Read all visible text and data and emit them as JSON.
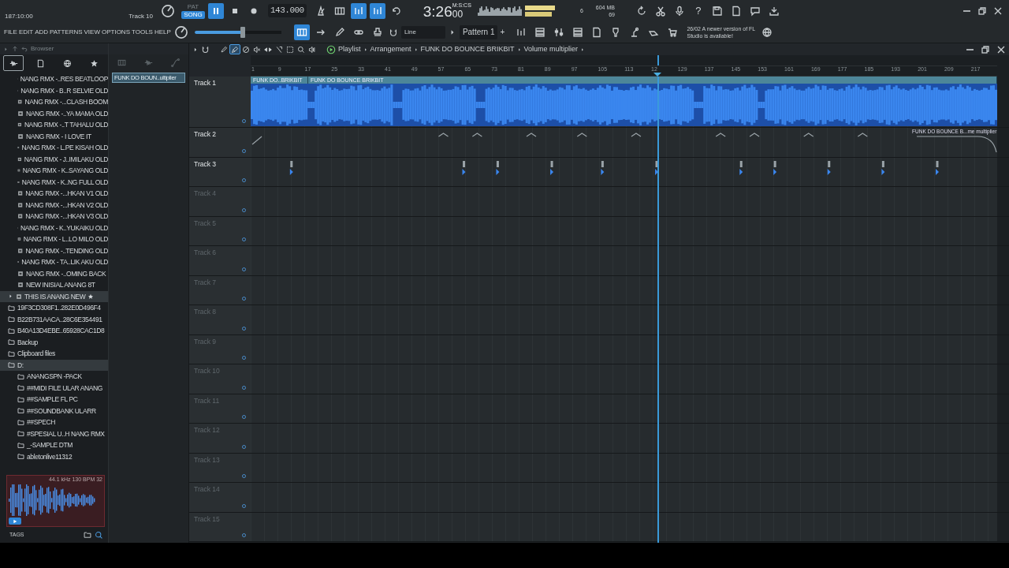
{
  "status": {
    "hint": "187:10:00",
    "track": "Track 10"
  },
  "transport": {
    "modes": [
      {
        "label": "PAT",
        "selected": false
      },
      {
        "label": "SONG",
        "selected": true
      }
    ],
    "playing": true,
    "tempo": "143.000"
  },
  "toggles": [
    {
      "on": false
    },
    {
      "on": false
    },
    {
      "on": true
    },
    {
      "on": true
    },
    {
      "on": false
    }
  ],
  "clock": {
    "time": "3:26",
    "fraction": "00",
    "unit": "M:S:CS"
  },
  "monitor": {
    "cpu": "6",
    "memory": "604 MB",
    "voices": "69"
  },
  "help_label": "?",
  "menu": [
    "FILE",
    "EDIT",
    "ADD",
    "PATTERNS",
    "VIEW",
    "OPTIONS",
    "TOOLS",
    "HELP"
  ],
  "master_volume": {
    "level": 0.56
  },
  "toggles2": [
    {
      "on": true
    },
    {
      "on": false
    },
    {
      "on": false
    },
    {
      "on": false
    },
    {
      "on": false
    }
  ],
  "snap": "Line",
  "pattern": {
    "name": "Pattern 1",
    "add": "+"
  },
  "news": {
    "date": "26/02",
    "text": "A newer version of FL Studio is available!"
  },
  "browser": {
    "title": "Browser",
    "tabs": [
      {
        "selected": true
      },
      {
        "selected": false
      },
      {
        "selected": false
      },
      {
        "selected": false
      }
    ],
    "items": [
      {
        "kind": "file",
        "label": "NANG RMX -..RES BEATLOOP"
      },
      {
        "kind": "file",
        "label": "NANG RMX - B..R SELVIE OLD"
      },
      {
        "kind": "file",
        "label": "NANG RMX -...CLASH BOOM"
      },
      {
        "kind": "file",
        "label": "NANG RMX -..YA MAMA OLD"
      },
      {
        "kind": "file",
        "label": "NANG RMX -..T TAHALU OLD"
      },
      {
        "kind": "file",
        "label": "NANG RMX - I LOVE IT"
      },
      {
        "kind": "file",
        "label": "NANG RMX - L.PE KISAH OLD"
      },
      {
        "kind": "file",
        "label": "NANG RMX - J..IMILAKU OLD"
      },
      {
        "kind": "file",
        "label": "NANG RMX - K..SAYANG OLD"
      },
      {
        "kind": "file",
        "label": "NANG RMX - K..NG FULL OLD"
      },
      {
        "kind": "file",
        "label": "NANG RMX -...HKAN V1 OLD"
      },
      {
        "kind": "file",
        "label": "NANG RMX -...HKAN V2 OLD"
      },
      {
        "kind": "file",
        "label": "NANG RMX -...HKAN V3 OLD"
      },
      {
        "kind": "file",
        "label": "NANG RMX - K..YUKAIKU OLD"
      },
      {
        "kind": "file",
        "label": "NANG RMX - L..LO MILO OLD"
      },
      {
        "kind": "file",
        "label": "NANG RMX -..TENDING OLD"
      },
      {
        "kind": "file",
        "label": "NANG RMX - TA..LIK AKU OLD"
      },
      {
        "kind": "file",
        "label": "NANG RMX -..OMING BACK"
      },
      {
        "kind": "file",
        "label": "NEW INISIAL ANANG 8T"
      },
      {
        "kind": "pinned",
        "label": "THIS IS ANANG NEW",
        "selected": true
      },
      {
        "kind": "folder",
        "label": "19F3CD308F1..282E0D496F4",
        "selected": false
      },
      {
        "kind": "folder",
        "label": "B22B731AACA..28C6E354491",
        "selected": false
      },
      {
        "kind": "folder",
        "label": "B40A13D4EBE..65928CAC1D8",
        "selected": false
      },
      {
        "kind": "folder",
        "label": "Backup",
        "selected": false
      },
      {
        "kind": "folder",
        "label": "Clipboard files",
        "selected": false
      },
      {
        "kind": "folder",
        "label": "D:",
        "selected": true,
        "children": [
          {
            "kind": "folder",
            "label": "ANANGSPN -PACK"
          },
          {
            "kind": "folder",
            "label": "##MIDI FILE ULAR ANANG"
          },
          {
            "kind": "folder",
            "label": "##SAMPLE FL PC"
          },
          {
            "kind": "folder",
            "label": "##SOUNDBANK ULARR"
          },
          {
            "kind": "folder",
            "label": "##SPECH"
          },
          {
            "kind": "folder",
            "label": "#SPESIAL U..H NANG RMX"
          },
          {
            "kind": "folder",
            "label": "_-SAMPLE DTM"
          },
          {
            "kind": "folder",
            "label": "abletonlive11312"
          }
        ]
      }
    ]
  },
  "preview": {
    "info": "44.1 kHz 130 BPM 32",
    "tags": "TAGS"
  },
  "picker": {
    "clips": [
      {
        "label": "FUNK DO BOUN..ultiplier",
        "selected": true
      }
    ]
  },
  "playlist": {
    "tools": [
      {
        "selected": false
      },
      {
        "selected": true
      },
      {
        "selected": false
      },
      {
        "selected": false
      },
      {
        "selected": false
      },
      {
        "selected": false
      },
      {
        "selected": false
      },
      {
        "selected": false
      },
      {
        "selected": false
      }
    ],
    "breadcrumb": [
      "Playlist",
      "Arrangement",
      "FUNK DO BOUNCE BRIKBIT",
      "Volume multiplier"
    ],
    "ruler": [
      "1",
      "9",
      "17",
      "25",
      "33",
      "41",
      "49",
      "57",
      "65",
      "73",
      "81",
      "89",
      "97",
      "105",
      "113",
      "12",
      "129",
      "137",
      "145",
      "153",
      "161",
      "169",
      "177",
      "185",
      "193",
      "201",
      "209",
      "217"
    ],
    "playhead": {
      "level": 0.545
    },
    "tracks": [
      {
        "name": "Track 1",
        "kind": "audio",
        "clips": [
          "FUNK DO..BRIKBIT",
          "FUNK DO BOUNCE BRIKBIT"
        ]
      },
      {
        "name": "Track 2",
        "kind": "automation",
        "clips": [
          "FUNK DO BOUNCE B...me multiplier"
        ]
      },
      {
        "name": "Track 3",
        "kind": "pattern"
      },
      {
        "name": "Track 4",
        "kind": "empty"
      },
      {
        "name": "Track 5",
        "kind": "empty"
      },
      {
        "name": "Track 6",
        "kind": "empty"
      },
      {
        "name": "Track 7",
        "kind": "empty"
      },
      {
        "name": "Track 8",
        "kind": "empty"
      },
      {
        "name": "Track 9",
        "kind": "empty"
      },
      {
        "name": "Track 10",
        "kind": "empty"
      },
      {
        "name": "Track 11",
        "kind": "empty"
      },
      {
        "name": "Track 12",
        "kind": "empty"
      },
      {
        "name": "Track 13",
        "kind": "empty"
      },
      {
        "name": "Track 14",
        "kind": "empty"
      },
      {
        "name": "Track 15",
        "kind": "empty"
      }
    ]
  }
}
